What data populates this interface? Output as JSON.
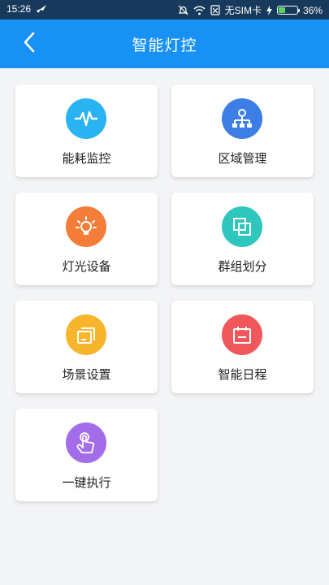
{
  "status_bar": {
    "time": "15:26",
    "carrier": "无SIM卡",
    "battery_percent": "36%",
    "battery_level": 0.36
  },
  "header": {
    "title": "智能灯控"
  },
  "menu": {
    "items": [
      {
        "label": "能耗监控",
        "icon": "pulse-icon",
        "color": "#29b3f3"
      },
      {
        "label": "区域管理",
        "icon": "hierarchy-icon",
        "color": "#3c7de6"
      },
      {
        "label": "灯光设备",
        "icon": "lightbulb-icon",
        "color": "#f57d3a"
      },
      {
        "label": "群组划分",
        "icon": "overlap-squares-icon",
        "color": "#2ec6bd"
      },
      {
        "label": "场景设置",
        "icon": "stacked-frames-icon",
        "color": "#f7b52c"
      },
      {
        "label": "智能日程",
        "icon": "calendar-icon",
        "color": "#f0575b"
      },
      {
        "label": "一键执行",
        "icon": "tap-hand-icon",
        "color": "#a36ce8"
      }
    ]
  }
}
